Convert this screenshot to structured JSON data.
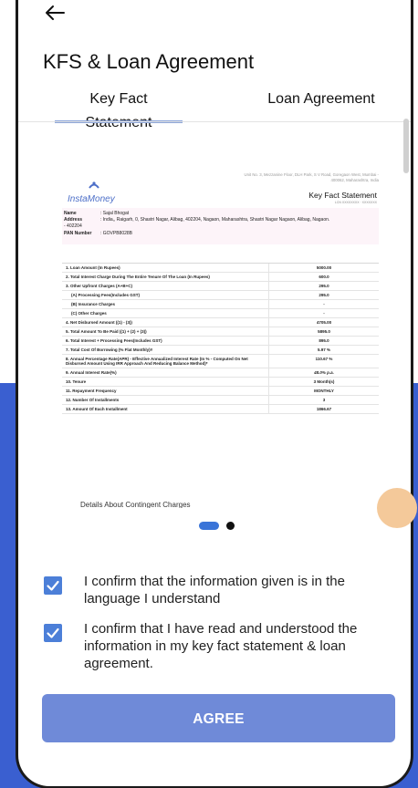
{
  "header": {
    "title": "KFS & Loan Agreement"
  },
  "tabs": [
    {
      "label": "Key Fact Statement",
      "active": true
    },
    {
      "label": "Loan Agreement",
      "active": false
    }
  ],
  "document": {
    "address": "Unit No. 3, Mezzanine Floor, DLH Park, S V Road, Goregaon West, Mumbai - 400062, Maharashtra, India",
    "brand": "InstaMoney",
    "heading": "Key Fact Statement",
    "ref": "LCN XXXXXXXX · XXXXXXX",
    "customer": {
      "name_label": "Name",
      "name": ": Sajal Bhogat",
      "address_label": "Address",
      "address": ": India,, Raigarh, 0, Shastri Nagar, Alibag, 402204, Nagaon, Maharashtra, Shastri Nagar Nagaon, Alibag, Nagaon.",
      "address_cont": "- 402204",
      "pan_label": "PAN Number",
      "pan": ": GOVPB8028B"
    },
    "kfs_rows": [
      {
        "label": "1. Loan Amount (In Rupees)",
        "value": "5000.00"
      },
      {
        "label": "2. Total Interest Charge During The Entire Tenure Of The Loan (In Rupees)",
        "value": "600.0"
      },
      {
        "label": "3. Other Upfront Charges (A+B+C)",
        "value": "295.0"
      },
      {
        "label": "(A) Processing Fees(Includes GST)",
        "value": "295.0"
      },
      {
        "label": "(B) Insurance Charges",
        "value": "-"
      },
      {
        "label": "(C) Other Charges",
        "value": "-"
      },
      {
        "label": "4. Net Disbursed Amount ((1) - (3))",
        "value": "4705.00"
      },
      {
        "label": "5. Total Amount To Be Paid ((1) + (2) + (3))",
        "value": "5895.0"
      },
      {
        "label": "6. Total Interest + Processing Fees(Includes GST)",
        "value": "895.0"
      },
      {
        "label": "7. Total Cost Of Borrowing (% Flat Monthly)#",
        "value": "5.97 %"
      },
      {
        "label": "8. Annual Percentage Rate(APR) - Effective Annualized Interest Rate (In % - Computed On Net Disbursed Amount Using IRR Approach And Reducing Balance Method)*",
        "value": "110.67 %"
      },
      {
        "label": "9. Annual Interest Rate(%)",
        "value": "48.0% p.a.",
        "italic": true
      },
      {
        "label": "10. Tenure",
        "value": "3 Month(s)"
      },
      {
        "label": "11. Repayment Frequency",
        "value": "MONTHLY"
      },
      {
        "label": "12. Number Of Installments",
        "value": "3"
      },
      {
        "label": "13. Amount Of Each Installment",
        "value": "1866.67"
      }
    ],
    "next_section": "Details About Contingent Charges"
  },
  "confirmations": [
    {
      "text": "I confirm that the information given is in the language I understand",
      "checked": true
    },
    {
      "text": "I confirm that I have read and understood the information in my key fact statement & loan agreement.",
      "checked": true
    }
  ],
  "agree_label": "AGREE",
  "colors": {
    "accent": "#4c7fd8",
    "button": "#6f8ad8",
    "tab_indicator": "#8aa3d8",
    "background_blue": "#3a5fd0"
  }
}
